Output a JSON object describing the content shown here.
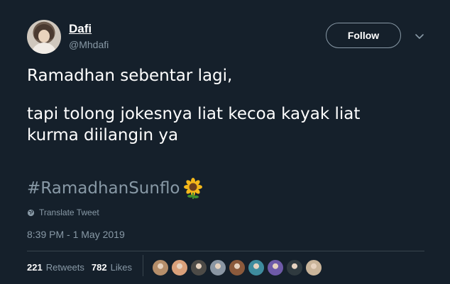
{
  "user": {
    "name": "Dafi",
    "handle": "@Mhdafi"
  },
  "follow_label": "Follow",
  "tweet": {
    "line1": "Ramadhan sebentar lagi,",
    "line2": "tapi tolong jokesnya liat kecoa kayak liat",
    "line3": "kurma diilangin ya",
    "hashtag": "#RamadhanSunflo",
    "emoji": "sunflower"
  },
  "translate_label": "Translate Tweet",
  "timestamp": "8:39 PM - 1 May 2019",
  "stats": {
    "retweets_count": "221",
    "retweets_label": "Retweets",
    "likes_count": "782",
    "likes_label": "Likes"
  },
  "likers": [
    {
      "name": "liker-avatar-1",
      "color": "#b58e6a"
    },
    {
      "name": "liker-avatar-2",
      "color": "#d9a07a"
    },
    {
      "name": "liker-avatar-3",
      "color": "#4d4b47"
    },
    {
      "name": "liker-avatar-4",
      "color": "#8a96a3"
    },
    {
      "name": "liker-avatar-5",
      "color": "#8b5a3c"
    },
    {
      "name": "liker-avatar-6",
      "color": "#3e8c9e"
    },
    {
      "name": "liker-avatar-7",
      "color": "#6e5aa8"
    },
    {
      "name": "liker-avatar-8",
      "color": "#2f3a3f"
    },
    {
      "name": "liker-avatar-9",
      "color": "#c9b49a"
    }
  ],
  "colors": {
    "background": "#15202b",
    "muted_text": "#8899a6",
    "divider": "#38444d"
  }
}
